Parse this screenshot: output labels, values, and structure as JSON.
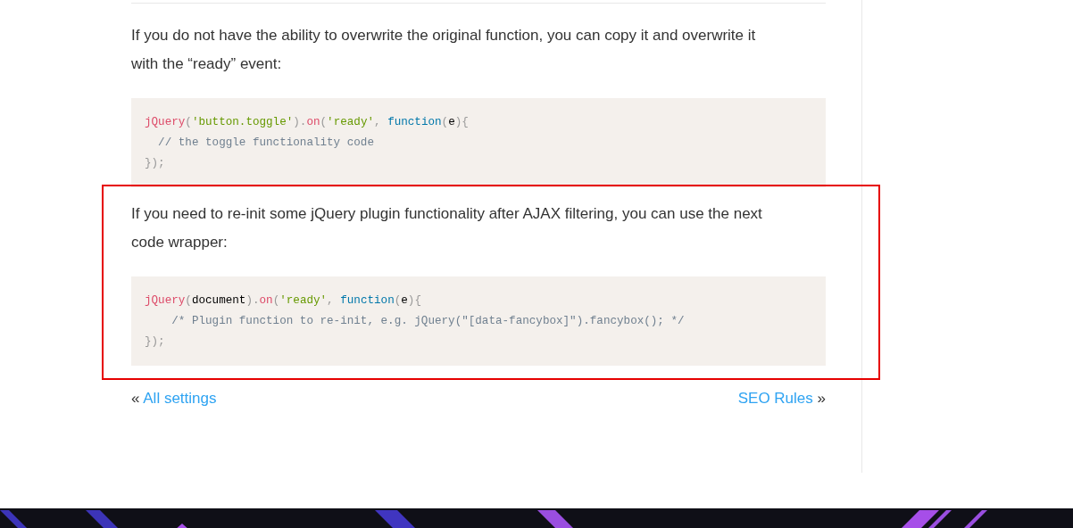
{
  "sections": [
    {
      "highlighted": false,
      "paragraph": "If you do not have the ability to overwrite the original function, you can copy it and overwrite it with the “ready” event:",
      "code": [
        [
          {
            "kind": "function",
            "text": "jQuery"
          },
          {
            "kind": "punct",
            "text": "("
          },
          {
            "kind": "string",
            "text": "'button.toggle'"
          },
          {
            "kind": "punct",
            "text": ")."
          },
          {
            "kind": "function",
            "text": "on"
          },
          {
            "kind": "punct",
            "text": "("
          },
          {
            "kind": "string",
            "text": "'ready'"
          },
          {
            "kind": "punct",
            "text": ", "
          },
          {
            "kind": "keyword",
            "text": "function"
          },
          {
            "kind": "punct",
            "text": "("
          },
          {
            "kind": "plain",
            "text": "e"
          },
          {
            "kind": "punct",
            "text": "){"
          }
        ],
        [
          {
            "kind": "comment",
            "text": "  // the toggle functionality code"
          }
        ],
        [
          {
            "kind": "punct",
            "text": "});"
          }
        ]
      ]
    },
    {
      "highlighted": true,
      "paragraph": "If you need to re-init some jQuery plugin functionality after AJAX filtering, you can use the next code wrapper:",
      "code": [
        [
          {
            "kind": "function",
            "text": "jQuery"
          },
          {
            "kind": "punct",
            "text": "("
          },
          {
            "kind": "plain",
            "text": "document"
          },
          {
            "kind": "punct",
            "text": ")."
          },
          {
            "kind": "function",
            "text": "on"
          },
          {
            "kind": "punct",
            "text": "("
          },
          {
            "kind": "string",
            "text": "'ready'"
          },
          {
            "kind": "punct",
            "text": ", "
          },
          {
            "kind": "keyword",
            "text": "function"
          },
          {
            "kind": "punct",
            "text": "("
          },
          {
            "kind": "plain",
            "text": "e"
          },
          {
            "kind": "punct",
            "text": "){"
          }
        ],
        [
          {
            "kind": "comment",
            "text": "    /* Plugin function to re-init, e.g. jQuery(\"[data-fancybox]\").fancybox(); */"
          }
        ],
        [
          {
            "kind": "punct",
            "text": "});"
          }
        ]
      ]
    }
  ],
  "post_nav": {
    "previous": {
      "arrow": "«",
      "link": "All settings"
    },
    "next": {
      "link": "SEO Rules",
      "arrow": "»"
    }
  }
}
